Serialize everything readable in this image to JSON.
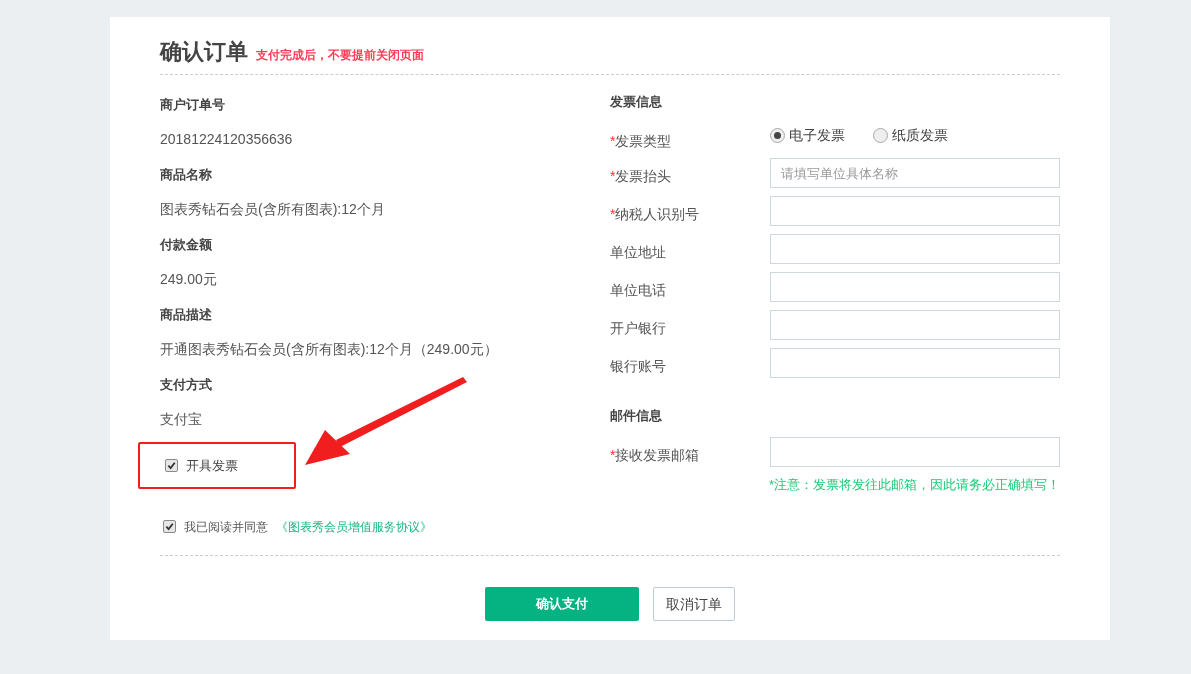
{
  "header": {
    "title": "确认订单",
    "notice": "支付完成后，不要提前关闭页面"
  },
  "order_info": [
    {
      "label": "商户订单号",
      "value": "20181224120356636"
    },
    {
      "label": "商品名称",
      "value": "图表秀钻石会员(含所有图表):12个月"
    },
    {
      "label": "付款金额",
      "value": "249.00元"
    },
    {
      "label": "商品描述",
      "value": "开通图表秀钻石会员(含所有图表):12个月（249.00元）"
    },
    {
      "label": "支付方式",
      "value": "支付宝"
    }
  ],
  "invoice_checkbox": {
    "label": "开具发票",
    "checked": true,
    "highlighted": true
  },
  "invoice": {
    "title": "发票信息",
    "fields": [
      {
        "kind": "radio",
        "label": "发票类型",
        "marker": "*",
        "options": [
          {
            "label": "电子发票",
            "selected": true
          },
          {
            "label": "纸质发票",
            "selected": false
          }
        ]
      },
      {
        "kind": "input",
        "label": "发票抬头",
        "marker": "*",
        "placeholder": "请填写单位具体名称"
      },
      {
        "kind": "input",
        "label": "纳税人识别号",
        "marker": "*"
      },
      {
        "kind": "input",
        "label": "单位地址"
      },
      {
        "kind": "input",
        "label": "单位电话"
      },
      {
        "kind": "input",
        "label": "开户银行"
      },
      {
        "kind": "input",
        "label": "银行账号"
      }
    ]
  },
  "mail": {
    "title": "邮件信息",
    "field": {
      "label": "接收发票邮箱",
      "marker": "*"
    },
    "note": "*注意：发票将发往此邮箱，因此请务必正确填写！"
  },
  "agreement": {
    "text": "我已阅读并同意",
    "link": "《图表秀会员增值服务协议》",
    "checked": true
  },
  "buttons": {
    "confirm": "确认支付",
    "cancel": "取消订单"
  }
}
